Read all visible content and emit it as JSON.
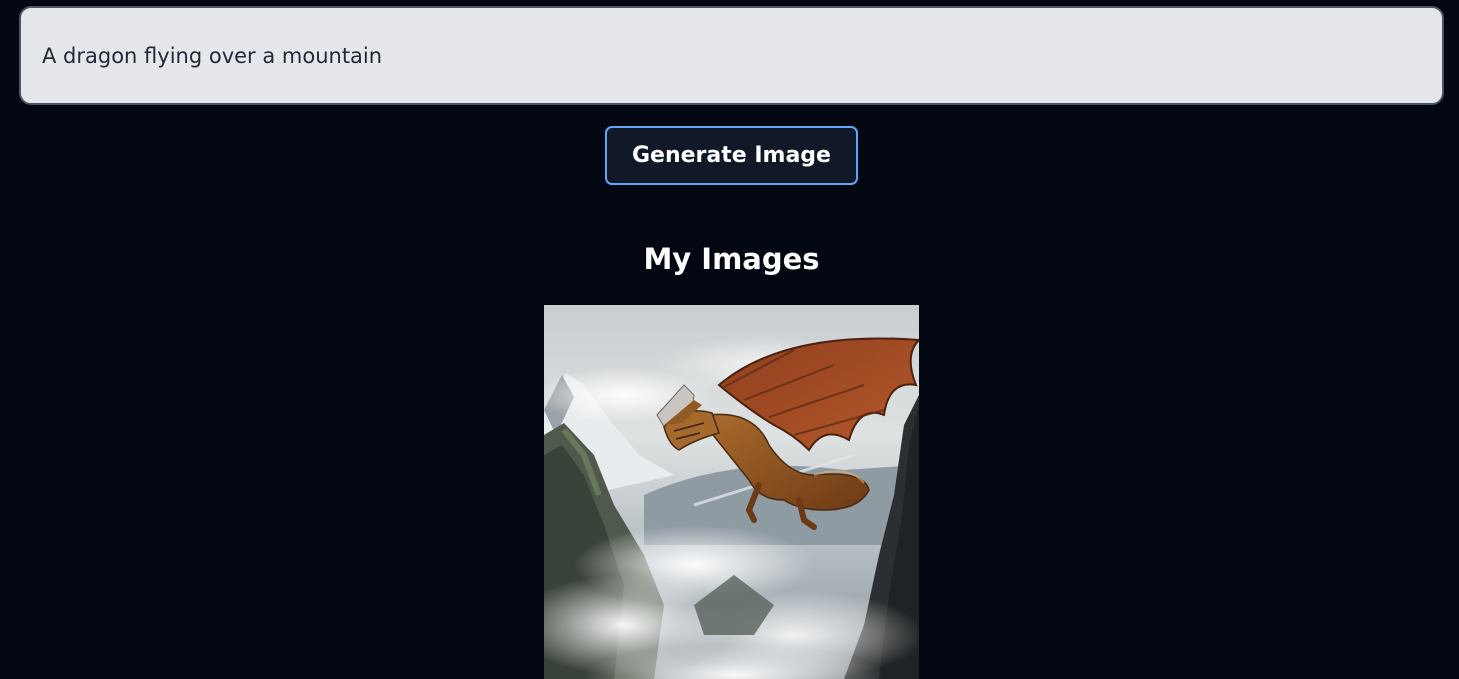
{
  "prompt": {
    "value": "A dragon flying over a mountain"
  },
  "generate_button": {
    "label": "Generate Image"
  },
  "gallery": {
    "title": "My Images",
    "images": [
      {
        "alt": "A dragon flying over a mountain"
      }
    ]
  },
  "colors": {
    "background": "#030712",
    "input_bg": "#e5e7eb",
    "button_border": "#60a5fa",
    "button_bg": "#111827"
  }
}
